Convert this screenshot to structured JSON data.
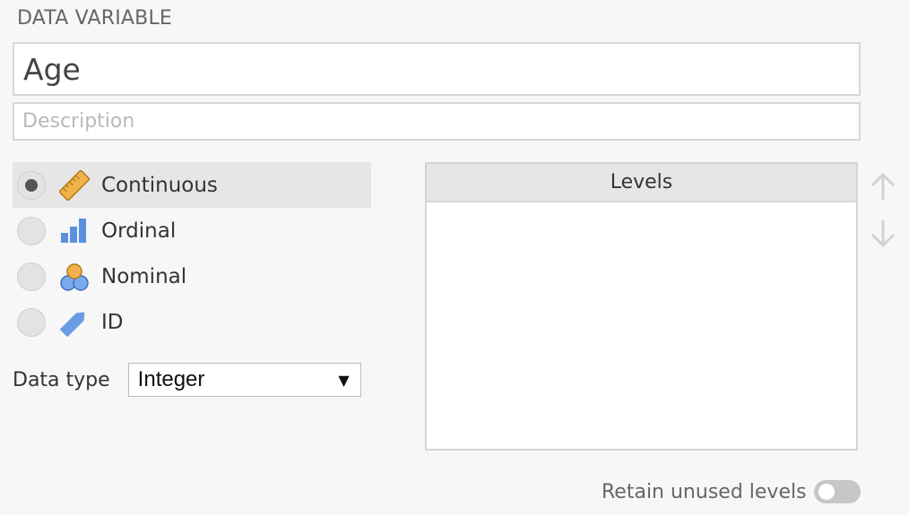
{
  "section_title": "DATA VARIABLE",
  "name_field": {
    "value": "Age"
  },
  "description_field": {
    "value": "",
    "placeholder": "Description"
  },
  "measure_types": [
    {
      "label": "Continuous",
      "icon": "ruler-icon",
      "selected": true
    },
    {
      "label": "Ordinal",
      "icon": "bar-chart-icon",
      "selected": false
    },
    {
      "label": "Nominal",
      "icon": "circles-icon",
      "selected": false
    },
    {
      "label": "ID",
      "icon": "tag-icon",
      "selected": false
    }
  ],
  "data_type": {
    "label": "Data type",
    "selected": "Integer"
  },
  "levels": {
    "header": "Levels",
    "items": []
  },
  "retain_unused_levels": {
    "label": "Retain unused levels",
    "enabled": false
  },
  "colors": {
    "ruler": "#f0b24a",
    "ordinal_blue": "#5b8fe0",
    "nominal_orange": "#f2b14d",
    "nominal_blue": "#7aa9ec",
    "id_blue": "#6b9be5",
    "disabled_arrow": "#d2d2d2"
  }
}
